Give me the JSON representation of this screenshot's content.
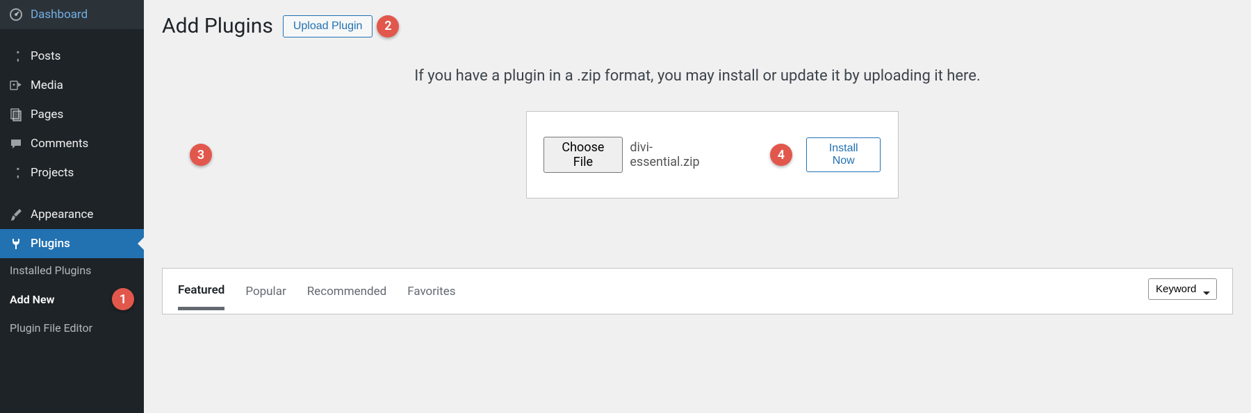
{
  "sidebar": {
    "items": [
      {
        "label": "Dashboard",
        "icon": "dashboard"
      },
      {
        "label": "Posts",
        "icon": "pin"
      },
      {
        "label": "Media",
        "icon": "media"
      },
      {
        "label": "Pages",
        "icon": "pages"
      },
      {
        "label": "Comments",
        "icon": "comments"
      },
      {
        "label": "Projects",
        "icon": "pin"
      },
      {
        "label": "Appearance",
        "icon": "brush"
      },
      {
        "label": "Plugins",
        "icon": "plug"
      }
    ],
    "subitems": [
      {
        "label": "Installed Plugins"
      },
      {
        "label": "Add New"
      },
      {
        "label": "Plugin File Editor"
      }
    ]
  },
  "page": {
    "title": "Add Plugins",
    "upload_button": "Upload Plugin",
    "instruction": "If you have a plugin in a .zip format, you may install or update it by uploading it here.",
    "choose_file": "Choose File",
    "file_name": "divi-essential.zip",
    "install_button": "Install Now"
  },
  "filter": {
    "tabs": [
      "Featured",
      "Popular",
      "Recommended",
      "Favorites"
    ],
    "select": "Keyword"
  },
  "annotations": [
    "1",
    "2",
    "3",
    "4"
  ]
}
